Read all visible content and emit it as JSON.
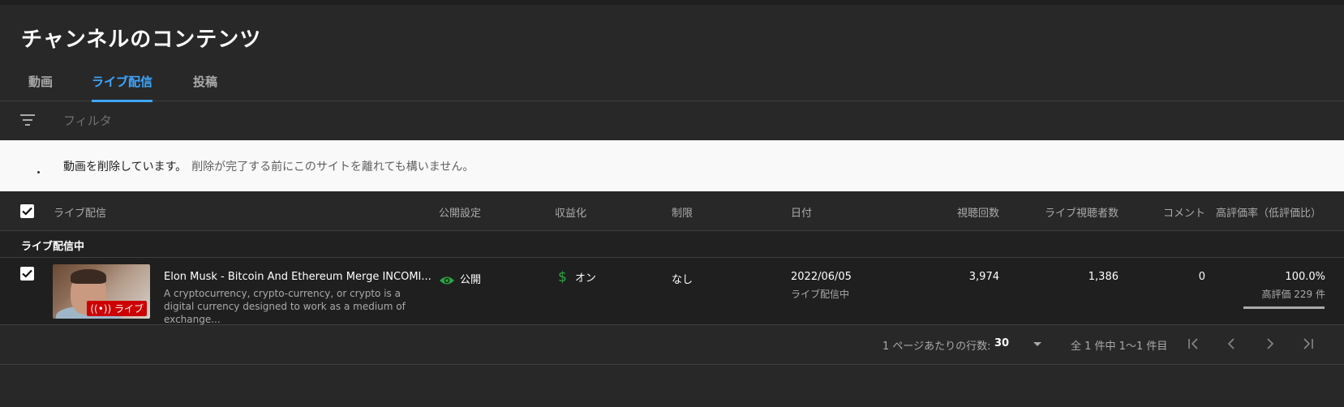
{
  "page_title": "チャンネルのコンテンツ",
  "tabs": [
    {
      "label": "動画",
      "active": false
    },
    {
      "label": "ライブ配信",
      "active": true
    },
    {
      "label": "投稿",
      "active": false
    }
  ],
  "filter": {
    "placeholder": "フィルタ",
    "icon": "filter-icon"
  },
  "banner": {
    "message": "動画を削除しています。",
    "detail": "削除が完了する前にこのサイトを離れても構いません。"
  },
  "table": {
    "columns": [
      "ライブ配信",
      "公開設定",
      "収益化",
      "制限",
      "日付",
      "視聴回数",
      "ライブ視聴者数",
      "コメント",
      "高評価率（低評価比）"
    ],
    "section_label": "ライブ配信中",
    "rows": [
      {
        "checked": true,
        "thumbnail_badge": "ライブ",
        "title": "Elon Musk - Bitcoin And Ethereum Merge INCOMI...",
        "description": "A cryptocurrency, crypto-currency, or crypto is a digital currency designed to work as a medium of exchange...",
        "visibility": "公開",
        "monetization": "オン",
        "restrictions": "なし",
        "date": "2022/06/05",
        "date_sub": "ライブ配信中",
        "views": "3,974",
        "live_viewers": "1,386",
        "comments": "0",
        "like_ratio": "100.0%",
        "likes_label": "高評価 229 件",
        "like_fraction": 1.0
      }
    ]
  },
  "pagination": {
    "rows_per_page_label": "1 ページあたりの行数:",
    "rows_per_page": "30",
    "range": "全 1 件中 1～1 件目"
  },
  "colors": {
    "accent": "#3ea6ff",
    "visibility_icon": "#2ba640",
    "monetization_icon": "#2ba640",
    "live_badge": "#cc0000"
  }
}
